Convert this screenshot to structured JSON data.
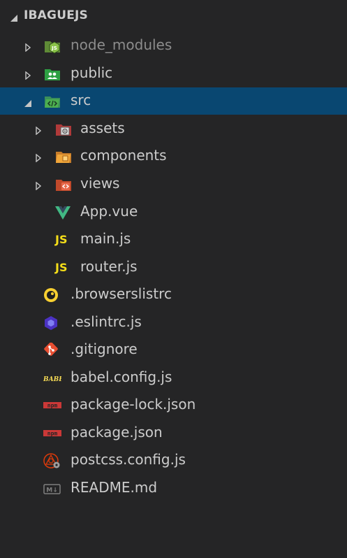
{
  "explorer": {
    "title": "IBAGUEJS",
    "items": [
      {
        "label": "node_modules",
        "kind": "folder",
        "icon": "node-folder-icon",
        "expanded": false,
        "depth": 1
      },
      {
        "label": "public",
        "kind": "folder",
        "icon": "public-folder-icon",
        "expanded": false,
        "depth": 1
      },
      {
        "label": "src",
        "kind": "folder",
        "icon": "src-folder-icon",
        "expanded": true,
        "selected": true,
        "depth": 1
      },
      {
        "label": "assets",
        "kind": "folder",
        "icon": "assets-folder-icon",
        "expanded": false,
        "depth": 2
      },
      {
        "label": "components",
        "kind": "folder",
        "icon": "components-folder-icon",
        "expanded": false,
        "depth": 2
      },
      {
        "label": "views",
        "kind": "folder",
        "icon": "views-folder-icon",
        "expanded": false,
        "depth": 2
      },
      {
        "label": "App.vue",
        "kind": "file",
        "icon": "vue-icon",
        "depth": 2
      },
      {
        "label": "main.js",
        "kind": "file",
        "icon": "javascript-icon",
        "depth": 2
      },
      {
        "label": "router.js",
        "kind": "file",
        "icon": "javascript-icon",
        "depth": 2
      },
      {
        "label": ".browserslistrc",
        "kind": "file",
        "icon": "browserslist-icon",
        "depth": 1
      },
      {
        "label": ".eslintrc.js",
        "kind": "file",
        "icon": "eslint-icon",
        "depth": 1
      },
      {
        "label": ".gitignore",
        "kind": "file",
        "icon": "git-icon",
        "depth": 1
      },
      {
        "label": "babel.config.js",
        "kind": "file",
        "icon": "babel-icon",
        "depth": 1
      },
      {
        "label": "package-lock.json",
        "kind": "file",
        "icon": "npm-icon",
        "depth": 1
      },
      {
        "label": "package.json",
        "kind": "file",
        "icon": "npm-icon",
        "depth": 1
      },
      {
        "label": "postcss.config.js",
        "kind": "file",
        "icon": "postcss-icon",
        "depth": 1
      },
      {
        "label": "README.md",
        "kind": "file",
        "icon": "markdown-icon",
        "depth": 1
      }
    ]
  },
  "icon_text": {
    "js": "JS",
    "babel": "BABEL",
    "npm": "npm",
    "node_js": "JS",
    "md": "M↓"
  },
  "colors": {
    "background": "#252526",
    "header_background": "#252526",
    "selected_row": "#094771",
    "text": "#cccccc",
    "dim_text": "#8c8c8c",
    "js_yellow": "#f5de19",
    "vue_green": "#41b883",
    "npm_red": "#cb3837",
    "git_red": "#e84e31",
    "eslint_purple": "#4b32c3"
  }
}
